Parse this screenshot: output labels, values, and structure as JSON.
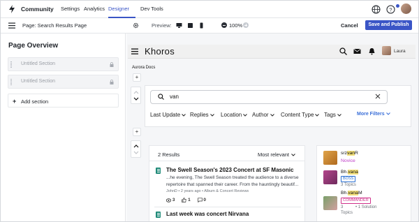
{
  "topnav": {
    "app_name": "Community",
    "items": [
      {
        "label": "Settings"
      },
      {
        "label": "Analytics"
      },
      {
        "label": "Designer"
      },
      {
        "label": "Dev Tools"
      }
    ],
    "accent": "#3a55c6"
  },
  "toolbar": {
    "page_label": "Page: Search Results Page",
    "preview_label": "Preview:",
    "zoom": "100%",
    "cancel": "Cancel",
    "save": "Save and Publish"
  },
  "left_panel": {
    "title": "Page Overview",
    "sections": [
      {
        "label": "Untitled Section"
      },
      {
        "label": "Untitled Section"
      }
    ],
    "add_section": "Add section"
  },
  "preview": {
    "brand": "Khoros",
    "user": "Laura",
    "breadcrumb": "Aurora Docs",
    "search": {
      "value": "van"
    },
    "filters": [
      {
        "label": "Last Update"
      },
      {
        "label": "Replies"
      },
      {
        "label": "Location"
      },
      {
        "label": "Author"
      },
      {
        "label": "Content Type"
      },
      {
        "label": "Tags"
      }
    ],
    "more_filters": "More Filters",
    "results": {
      "count_label": "2 Results",
      "sort_label": "Most relevant",
      "items": [
        {
          "title": "The Swell Season's 2023 Concert at SF Masonic",
          "snippet": "...he evening, The Swell Season treated the audience to a diverse repertoire that spanned their career. From the hauntingly beautif...",
          "meta": "JohnD • 2 years ago • Album & Concert Reviews",
          "views": "3",
          "likes": "1",
          "replies": "0"
        },
        {
          "title": "Last week was concert Nirvana"
        }
      ]
    },
    "users": [
      {
        "prefix": "srz",
        "highlight": "van",
        "suffix": "R",
        "role": "Novice",
        "role_color": "#c040c8"
      },
      {
        "prefix": "Bh.",
        "highlight": "vana",
        "suffix": "",
        "badge": "BOSS",
        "badge_color": "#2a6fd1",
        "topics": "3 Topics"
      },
      {
        "prefix": "Bh.",
        "highlight": "vana",
        "suffix": "M",
        "badge": "COMMANDER",
        "badge_color": "#d0308a",
        "topics": "3",
        "solutions": "• 1 Solution",
        "topics2": "Topics"
      }
    ]
  }
}
